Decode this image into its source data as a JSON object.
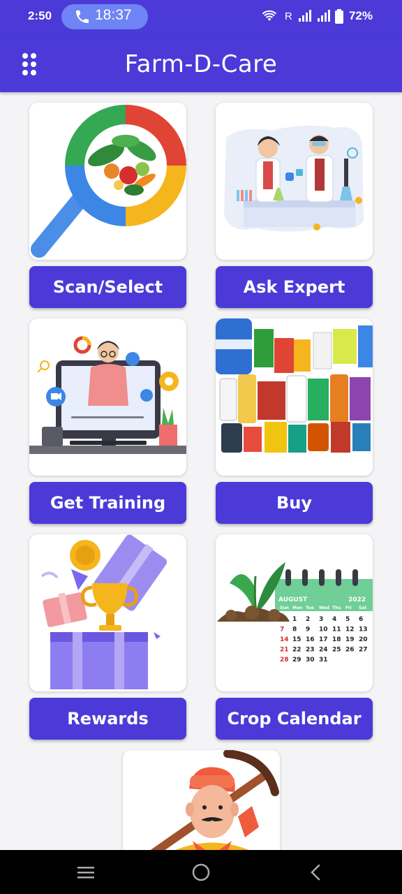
{
  "status_bar": {
    "time": "2:50",
    "call_duration": "18:37",
    "carrier_indicator": "R",
    "battery": "72%",
    "icons": [
      "phone-icon",
      "wifi-icon",
      "signal-icon",
      "signal-icon",
      "battery-icon"
    ]
  },
  "app_bar": {
    "title": "Farm-D-Care",
    "menu_icon": "grid-dots-icon"
  },
  "tiles": [
    {
      "label": "Scan/Select",
      "image": "magnifier-vegetables-illustration"
    },
    {
      "label": "Ask Expert",
      "image": "lab-scientists-illustration"
    },
    {
      "label": "Get Training",
      "image": "online-training-illustration"
    },
    {
      "label": "Buy",
      "image": "agro-products-illustration"
    },
    {
      "label": "Rewards",
      "image": "gift-trophy-illustration"
    },
    {
      "label": "Crop Calendar",
      "image": "plant-calendar-illustration"
    }
  ],
  "calendar": {
    "month": "AUGUST",
    "year": "2022",
    "weekdays": [
      "Sun",
      "Mon",
      "Tue",
      "Wed",
      "Thu",
      "Fri",
      "Sat"
    ],
    "rows": [
      [
        "",
        "1",
        "2",
        "3",
        "4",
        "5",
        "6"
      ],
      [
        "7",
        "8",
        "9",
        "10",
        "11",
        "12",
        "13"
      ],
      [
        "14",
        "15",
        "16",
        "17",
        "18",
        "19",
        "20"
      ],
      [
        "21",
        "22",
        "23",
        "24",
        "25",
        "26",
        "27"
      ],
      [
        "28",
        "29",
        "30",
        "31",
        "",
        "",
        ""
      ]
    ],
    "sunday_color": "#d62d2d"
  },
  "partial_tile": {
    "image": "farmer-with-pickaxe-illustration"
  },
  "nav_bar": {
    "icons": [
      "recents-icon",
      "home-icon",
      "back-icon"
    ]
  },
  "colors": {
    "primary": "#4b3ad8",
    "background": "#f4f4f6",
    "call_pill": "#6f84f5"
  }
}
